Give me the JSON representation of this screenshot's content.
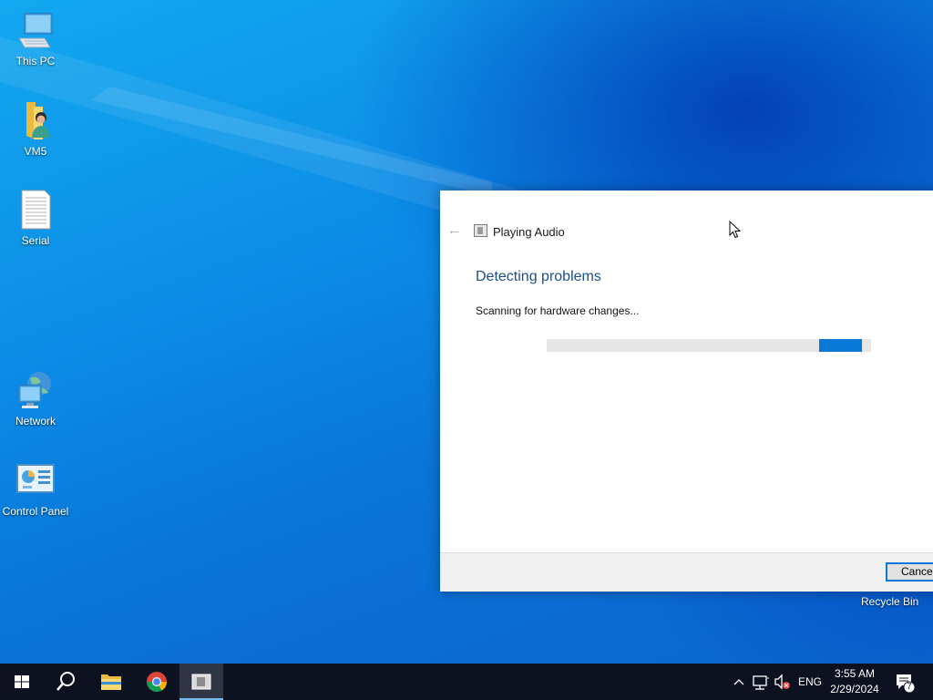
{
  "desktop": {
    "icons": [
      {
        "label": "This PC",
        "icon": "this-pc-icon"
      },
      {
        "label": "VM5",
        "icon": "user-folder-icon"
      },
      {
        "label": "Serial",
        "icon": "text-document-icon"
      },
      {
        "label": "Network",
        "icon": "network-icon"
      },
      {
        "label": "Control Panel",
        "icon": "control-panel-icon"
      }
    ],
    "recycle_bin_label": "Recycle Bin"
  },
  "dialog": {
    "title": "Playing Audio",
    "heading": "Detecting problems",
    "status": "Scanning for hardware changes...",
    "progress_indeterminate": true,
    "cancel_label": "Cancel",
    "accent_color": "#0a78d7",
    "heading_color": "#1c4e8a"
  },
  "taskbar": {
    "buttons": [
      {
        "name": "start",
        "icon": "windows-logo-icon"
      },
      {
        "name": "search",
        "icon": "search-icon"
      },
      {
        "name": "file-explorer",
        "icon": "folder-icon"
      },
      {
        "name": "chrome",
        "icon": "chrome-icon"
      },
      {
        "name": "troubleshooter",
        "icon": "troubleshooter-icon",
        "active": true
      }
    ],
    "tray": {
      "language": "ENG",
      "time": "3:55 AM",
      "date": "2/29/2024",
      "notification_count": "7"
    }
  }
}
